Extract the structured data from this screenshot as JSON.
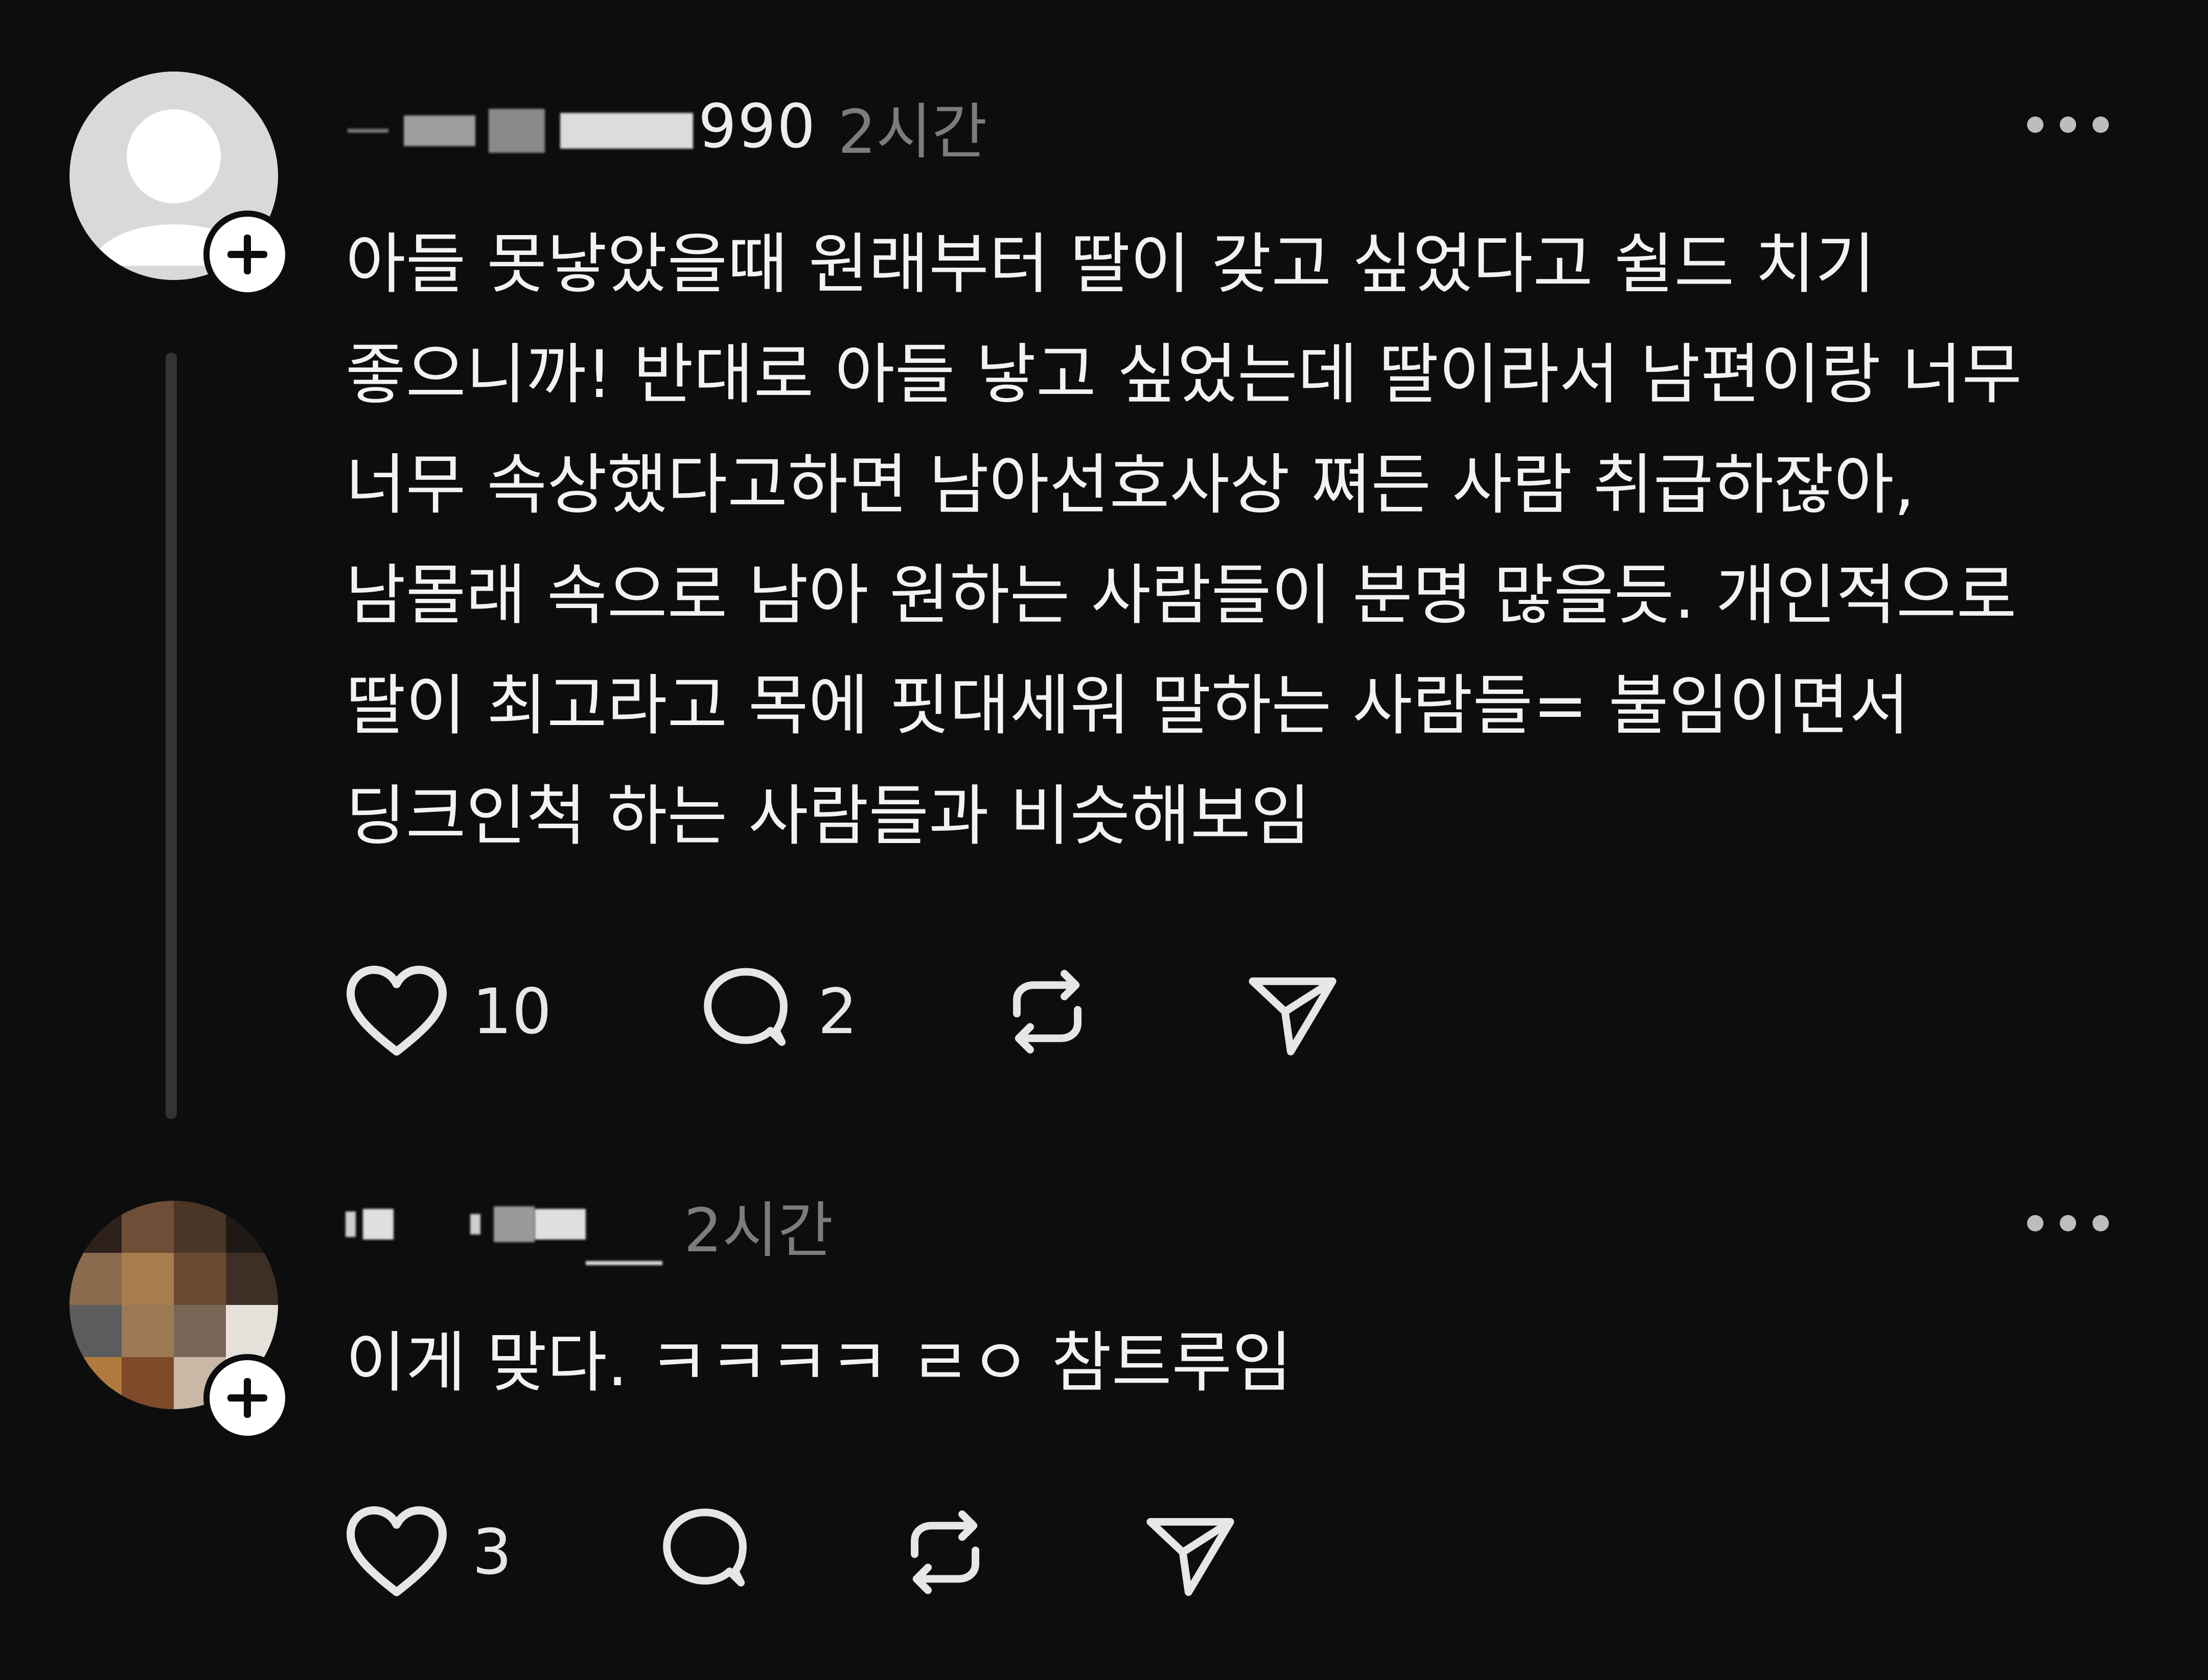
{
  "comments": [
    {
      "username": "ni 1990",
      "timestamp": "2시간",
      "text_lines": [
        "아들 못낳았을때 원래부터 딸이 갖고 싶었다고 쉴드 치기",
        "좋으니까! 반대로 아들 낳고 싶었는데 딸이라서 남편이랑 너무",
        "너무 속상했다고하면 남아선호사상 쪄든 사람 취급하잖아,",
        "남몰래 속으로 남아 원하는 사람들이 분명 많을듯. 개인적으로",
        "딸이 최고라고 목에 핏대세워 말하는 사람들= 불임이면서",
        "딩크인척 하는 사람들과 비슷해보임"
      ],
      "likes": "10",
      "replies": "2",
      "avatar": "default-user-icon"
    },
    {
      "username": "",
      "timestamp": "2시간",
      "text_lines": [
        "이게 맞다. ㅋㅋㅋㅋ ㄹㅇ 참트루임"
      ],
      "likes": "3",
      "replies": "",
      "avatar": "pixelated-photo"
    }
  ],
  "icons": {
    "like": "heart-icon",
    "reply": "comment-icon",
    "repost": "repost-icon",
    "share": "send-icon",
    "more": "more-dots-icon",
    "follow": "plus-icon"
  },
  "colors": {
    "background": "#0d0d0d",
    "text": "#f2f2f2",
    "muted": "#7c7c7c",
    "thread_line": "#343434"
  }
}
